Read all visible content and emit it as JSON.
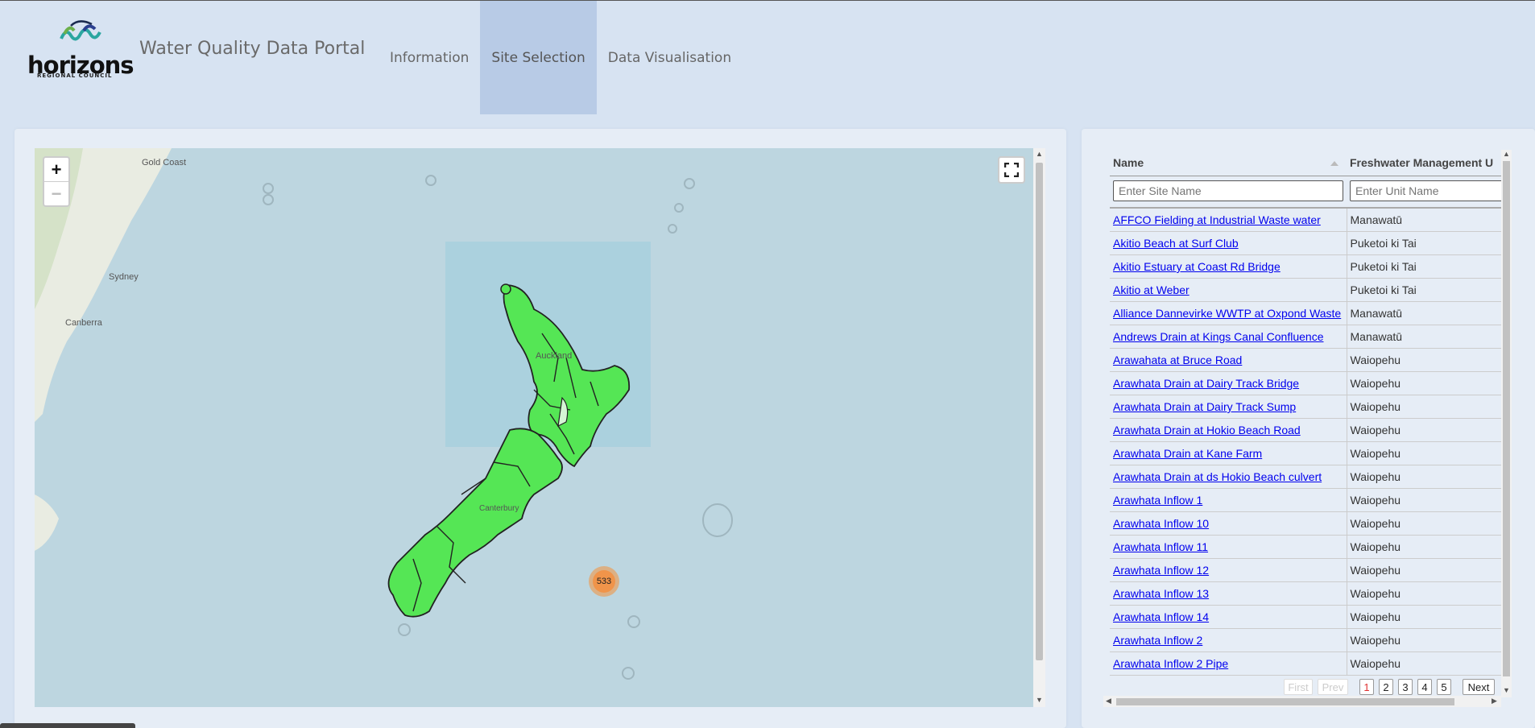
{
  "header": {
    "logo_text": "horizons",
    "logo_subtext": "REGIONAL COUNCIL",
    "title": "Water Quality Data Portal"
  },
  "nav": {
    "items": [
      {
        "label": "Information",
        "active": false
      },
      {
        "label": "Site Selection",
        "active": true
      },
      {
        "label": "Data Visualisation",
        "active": false
      }
    ]
  },
  "map": {
    "zoom_in": "+",
    "zoom_out": "−",
    "labels": {
      "gold_coast": "Gold Coast",
      "sydney": "Sydney",
      "canberra": "Canberra",
      "auckland": "Auckland",
      "canterbury": "Canterbury"
    },
    "cluster_count": "533",
    "colors": {
      "regions": "#55e655",
      "cluster": "#f0944a",
      "sea": "#bdd6e0"
    }
  },
  "table": {
    "columns": {
      "name": "Name",
      "unit": "Freshwater Management U"
    },
    "filters": {
      "name_placeholder": "Enter Site Name",
      "unit_placeholder": "Enter Unit Name"
    },
    "rows": [
      {
        "name": "AFFCO Fielding at Industrial Waste water",
        "unit": "Manawatū"
      },
      {
        "name": "Akitio Beach at Surf Club",
        "unit": "Puketoi ki Tai"
      },
      {
        "name": "Akitio Estuary at Coast Rd Bridge",
        "unit": "Puketoi ki Tai"
      },
      {
        "name": "Akitio at Weber",
        "unit": "Puketoi ki Tai"
      },
      {
        "name": "Alliance Dannevirke WWTP at Oxpond Waste",
        "unit": "Manawatū"
      },
      {
        "name": "Andrews Drain at Kings Canal Confluence",
        "unit": "Manawatū"
      },
      {
        "name": "Arawahata at Bruce Road",
        "unit": "Waiopehu"
      },
      {
        "name": "Arawhata Drain at Dairy Track Bridge",
        "unit": "Waiopehu"
      },
      {
        "name": "Arawhata Drain at Dairy Track Sump",
        "unit": "Waiopehu"
      },
      {
        "name": "Arawhata Drain at Hokio Beach Road",
        "unit": "Waiopehu"
      },
      {
        "name": "Arawhata Drain at Kane Farm",
        "unit": "Waiopehu"
      },
      {
        "name": "Arawhata Drain at ds Hokio Beach culvert",
        "unit": "Waiopehu"
      },
      {
        "name": "Arawhata Inflow 1",
        "unit": "Waiopehu"
      },
      {
        "name": "Arawhata Inflow 10",
        "unit": "Waiopehu"
      },
      {
        "name": "Arawhata Inflow 11",
        "unit": "Waiopehu"
      },
      {
        "name": "Arawhata Inflow 12",
        "unit": "Waiopehu"
      },
      {
        "name": "Arawhata Inflow 13",
        "unit": "Waiopehu"
      },
      {
        "name": "Arawhata Inflow 14",
        "unit": "Waiopehu"
      },
      {
        "name": "Arawhata Inflow 2",
        "unit": "Waiopehu"
      },
      {
        "name": "Arawhata Inflow 2 Pipe",
        "unit": "Waiopehu"
      }
    ],
    "pagination": {
      "first": "First",
      "prev": "Prev",
      "pages": [
        "1",
        "2",
        "3",
        "4",
        "5"
      ],
      "current": "1",
      "next": "Next"
    }
  }
}
